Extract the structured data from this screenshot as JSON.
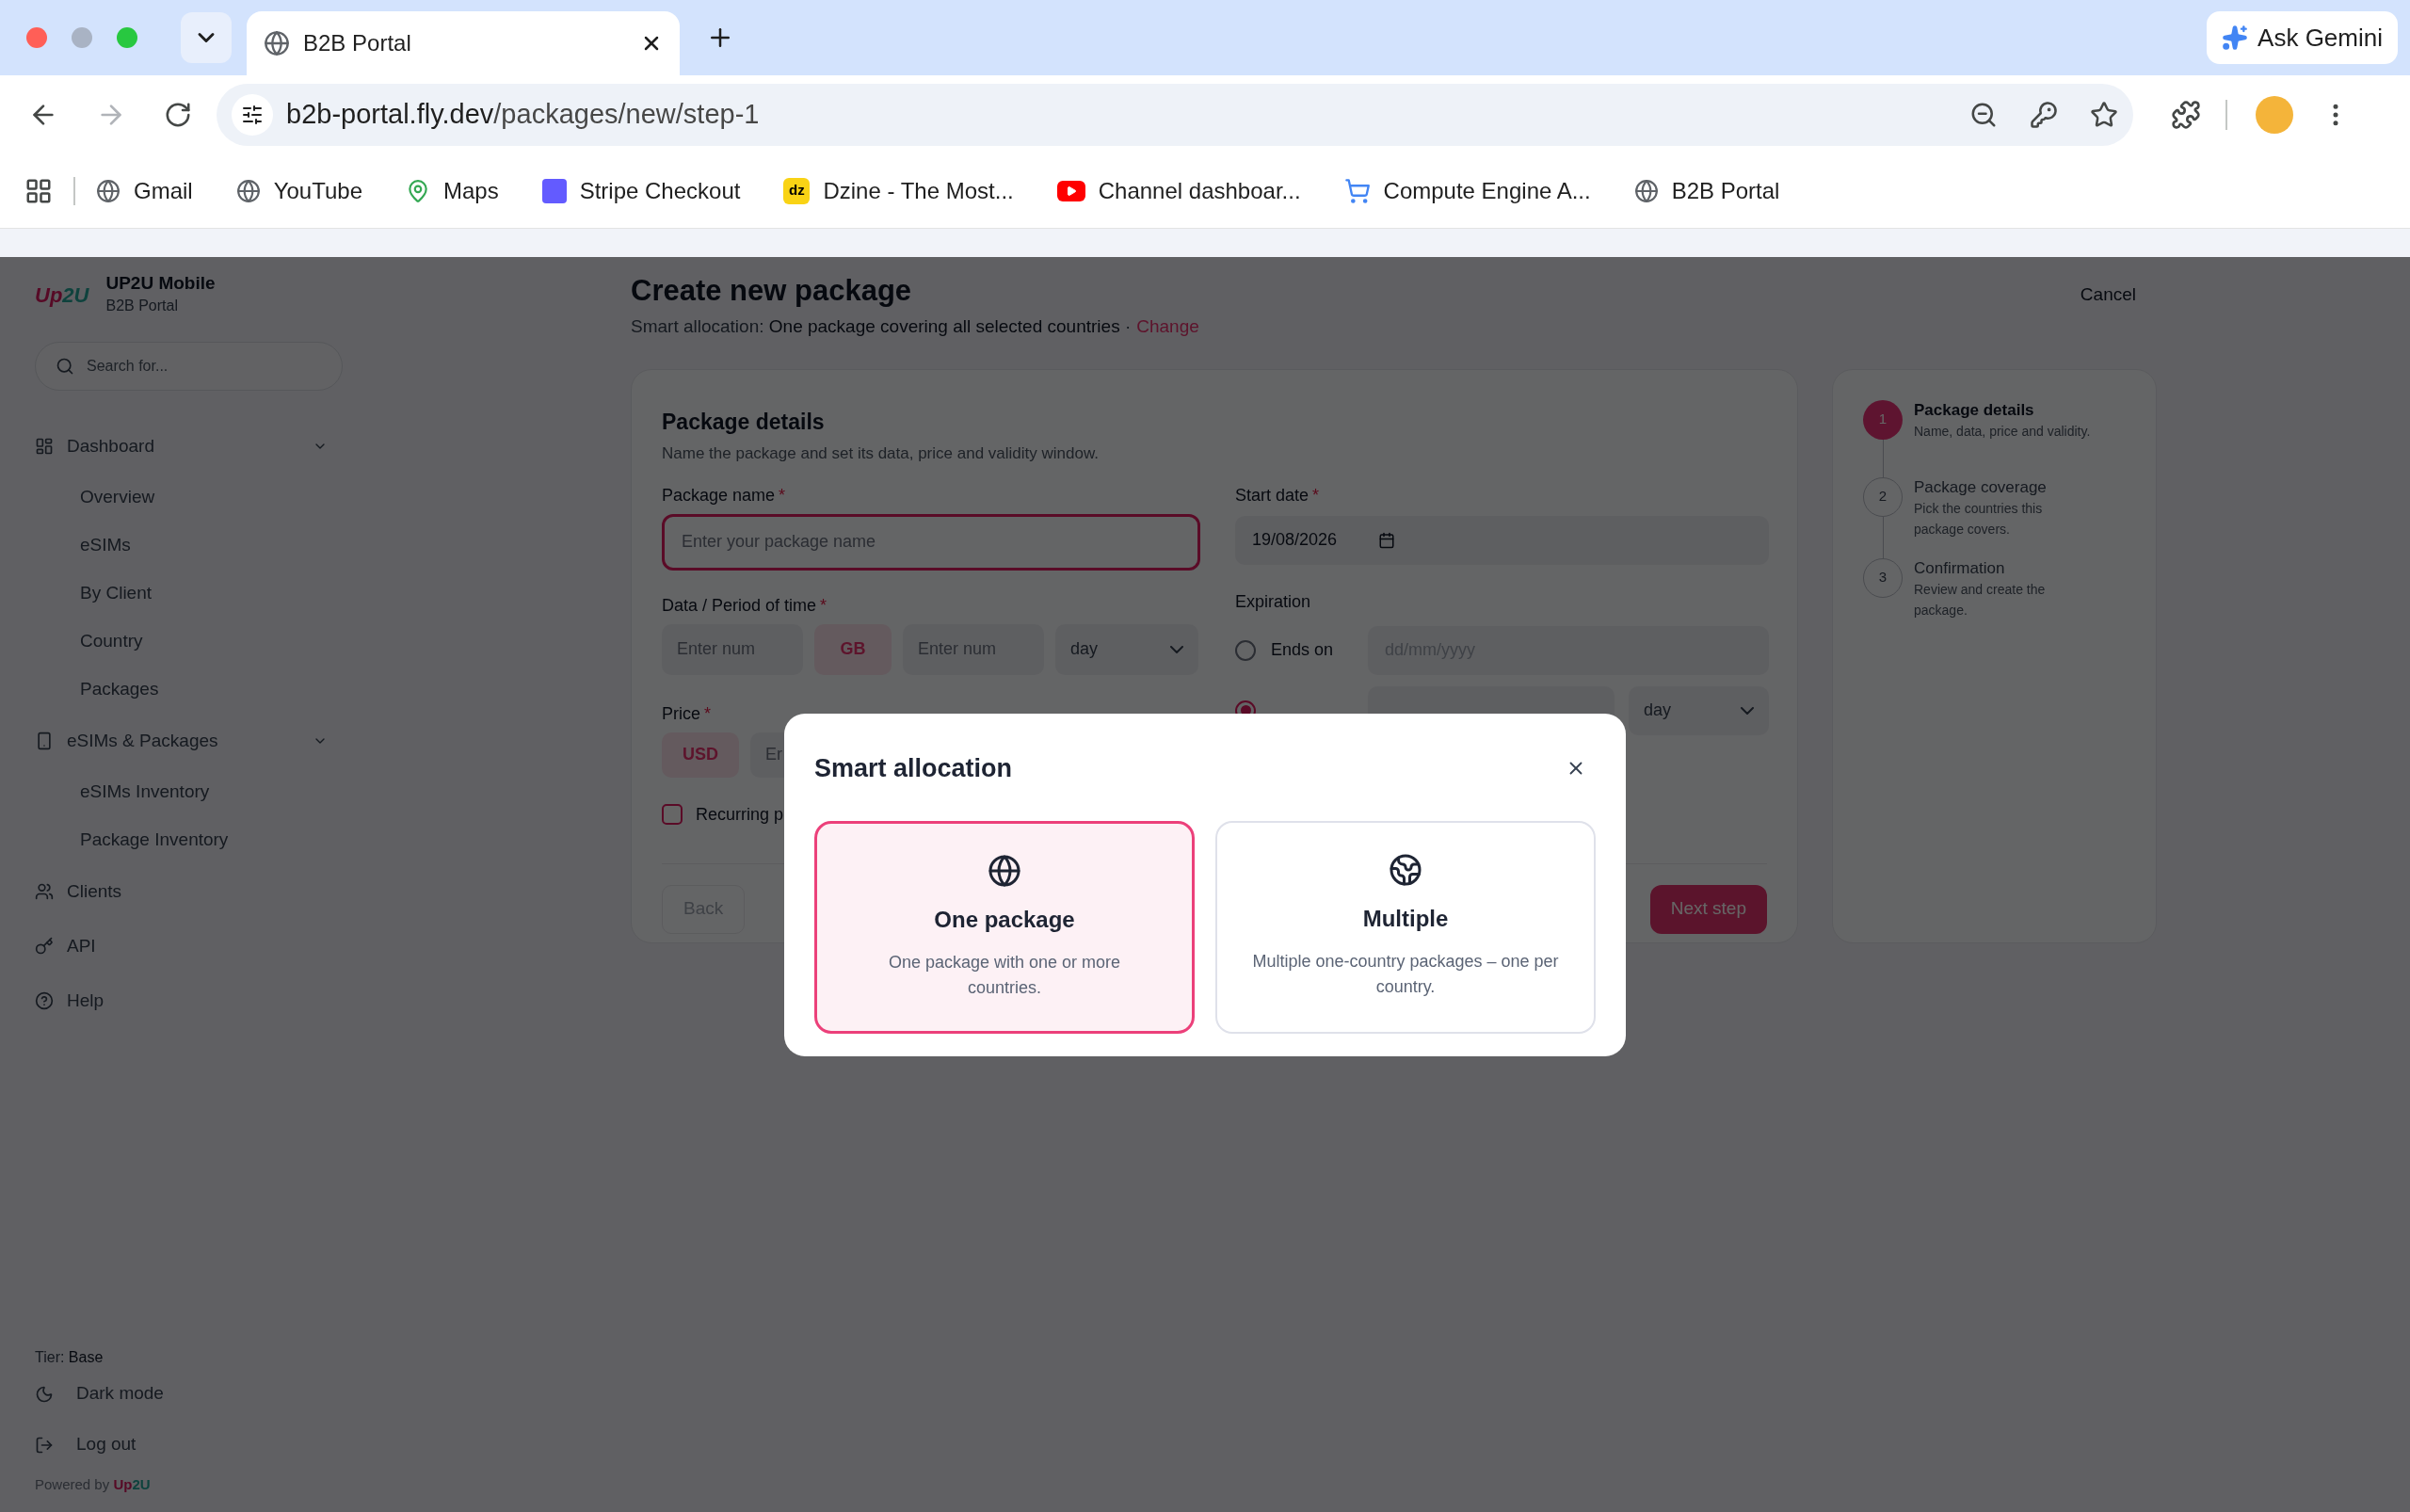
{
  "browser": {
    "tabs": [
      {
        "title": "B2B Portal",
        "selected": true
      }
    ],
    "ask_gemini": "Ask Gemini",
    "url_host": "b2b-portal.fly.dev",
    "url_path": "/packages/new/step-1",
    "forward_disabled": true,
    "bookmarks": [
      {
        "label": "Gmail",
        "kind": "globe"
      },
      {
        "label": "YouTube",
        "kind": "globe"
      },
      {
        "label": "Maps",
        "kind": "pin"
      },
      {
        "label": "Stripe Checkout",
        "kind": "stripe"
      },
      {
        "label": "Dzine - The Most...",
        "kind": "badge",
        "badge": "dz"
      },
      {
        "label": "Channel dashboar...",
        "kind": "video"
      },
      {
        "label": "Compute Engine A...",
        "kind": "cart"
      },
      {
        "label": "B2B Portal",
        "kind": "globe"
      }
    ]
  },
  "sidebar": {
    "logo_parts": [
      {
        "text": "Up"
      },
      {
        "text": "2U"
      }
    ],
    "brand": "UP2U Mobile",
    "subtitle": "B2B Portal",
    "search": {
      "placeholder": "Search for..."
    },
    "nav": [
      {
        "label": "Dashboard",
        "expanded": true,
        "children": [
          {
            "label": "Overview"
          },
          {
            "label": "eSIMs"
          },
          {
            "label": "By Client"
          },
          {
            "label": "Country"
          },
          {
            "label": "Packages"
          }
        ]
      },
      {
        "label": "eSIMs & Packages",
        "expanded": true,
        "children": [
          {
            "label": "eSIMs Inventory"
          },
          {
            "label": "Package Inventory"
          }
        ]
      },
      {
        "label": "Clients"
      },
      {
        "label": "API"
      },
      {
        "label": "Help"
      }
    ],
    "tier_label": "Tier:",
    "tier_value": "Base",
    "footer": [
      {
        "label": "Dark mode"
      },
      {
        "label": "Log out"
      }
    ],
    "powered_by": "Powered by",
    "powered_by_parts": [
      {
        "text": "Up"
      },
      {
        "text": "2U"
      }
    ]
  },
  "header": {
    "title": "Create new package",
    "subtitle_label": "Smart allocation:",
    "subtitle_value": "One package covering all selected countries",
    "separator": "·",
    "change_link": "Change",
    "cancel": "Cancel"
  },
  "form": {
    "title": "Package details",
    "description": "Name the package and set its data, price and validity window.",
    "package_name": {
      "label": "Package name",
      "required": "*",
      "placeholder": "Enter your package name",
      "invalid": true
    },
    "start_date": {
      "label": "Start date",
      "required": "*",
      "value": "19/08/2026"
    },
    "data_period": {
      "label": "Data / Period of time",
      "required": "*",
      "data_placeholder": "Enter num",
      "unit": "GB",
      "period_placeholder": "Enter num",
      "period_unit": "day"
    },
    "expiration": {
      "label": "Expiration",
      "options": [
        {
          "label": "Ends on",
          "selected": false,
          "placeholder": "dd/mm/yyyy"
        },
        {
          "selected": true,
          "unit": "day"
        }
      ]
    },
    "price": {
      "label": "Price",
      "required": "*",
      "currency": "USD",
      "placeholder": "Er"
    },
    "recurring": {
      "label": "Recurring p",
      "checked": false
    },
    "back": "Back",
    "next": "Next step"
  },
  "steps": [
    {
      "number": "1",
      "title": "Package details",
      "description": "Name, data, price and validity.",
      "selected": true
    },
    {
      "number": "2",
      "title": "Package coverage",
      "description": "Pick the countries this package covers.",
      "selected": false
    },
    {
      "number": "3",
      "title": "Confirmation",
      "description": "Review and create the package.",
      "selected": false
    }
  ],
  "modal": {
    "title": "Smart allocation",
    "options": [
      {
        "title": "One package",
        "description": "One package with one or more countries.",
        "selected": true
      },
      {
        "title": "Multiple",
        "description": "Multiple one-country packages – one per country.",
        "selected": false
      }
    ]
  }
}
